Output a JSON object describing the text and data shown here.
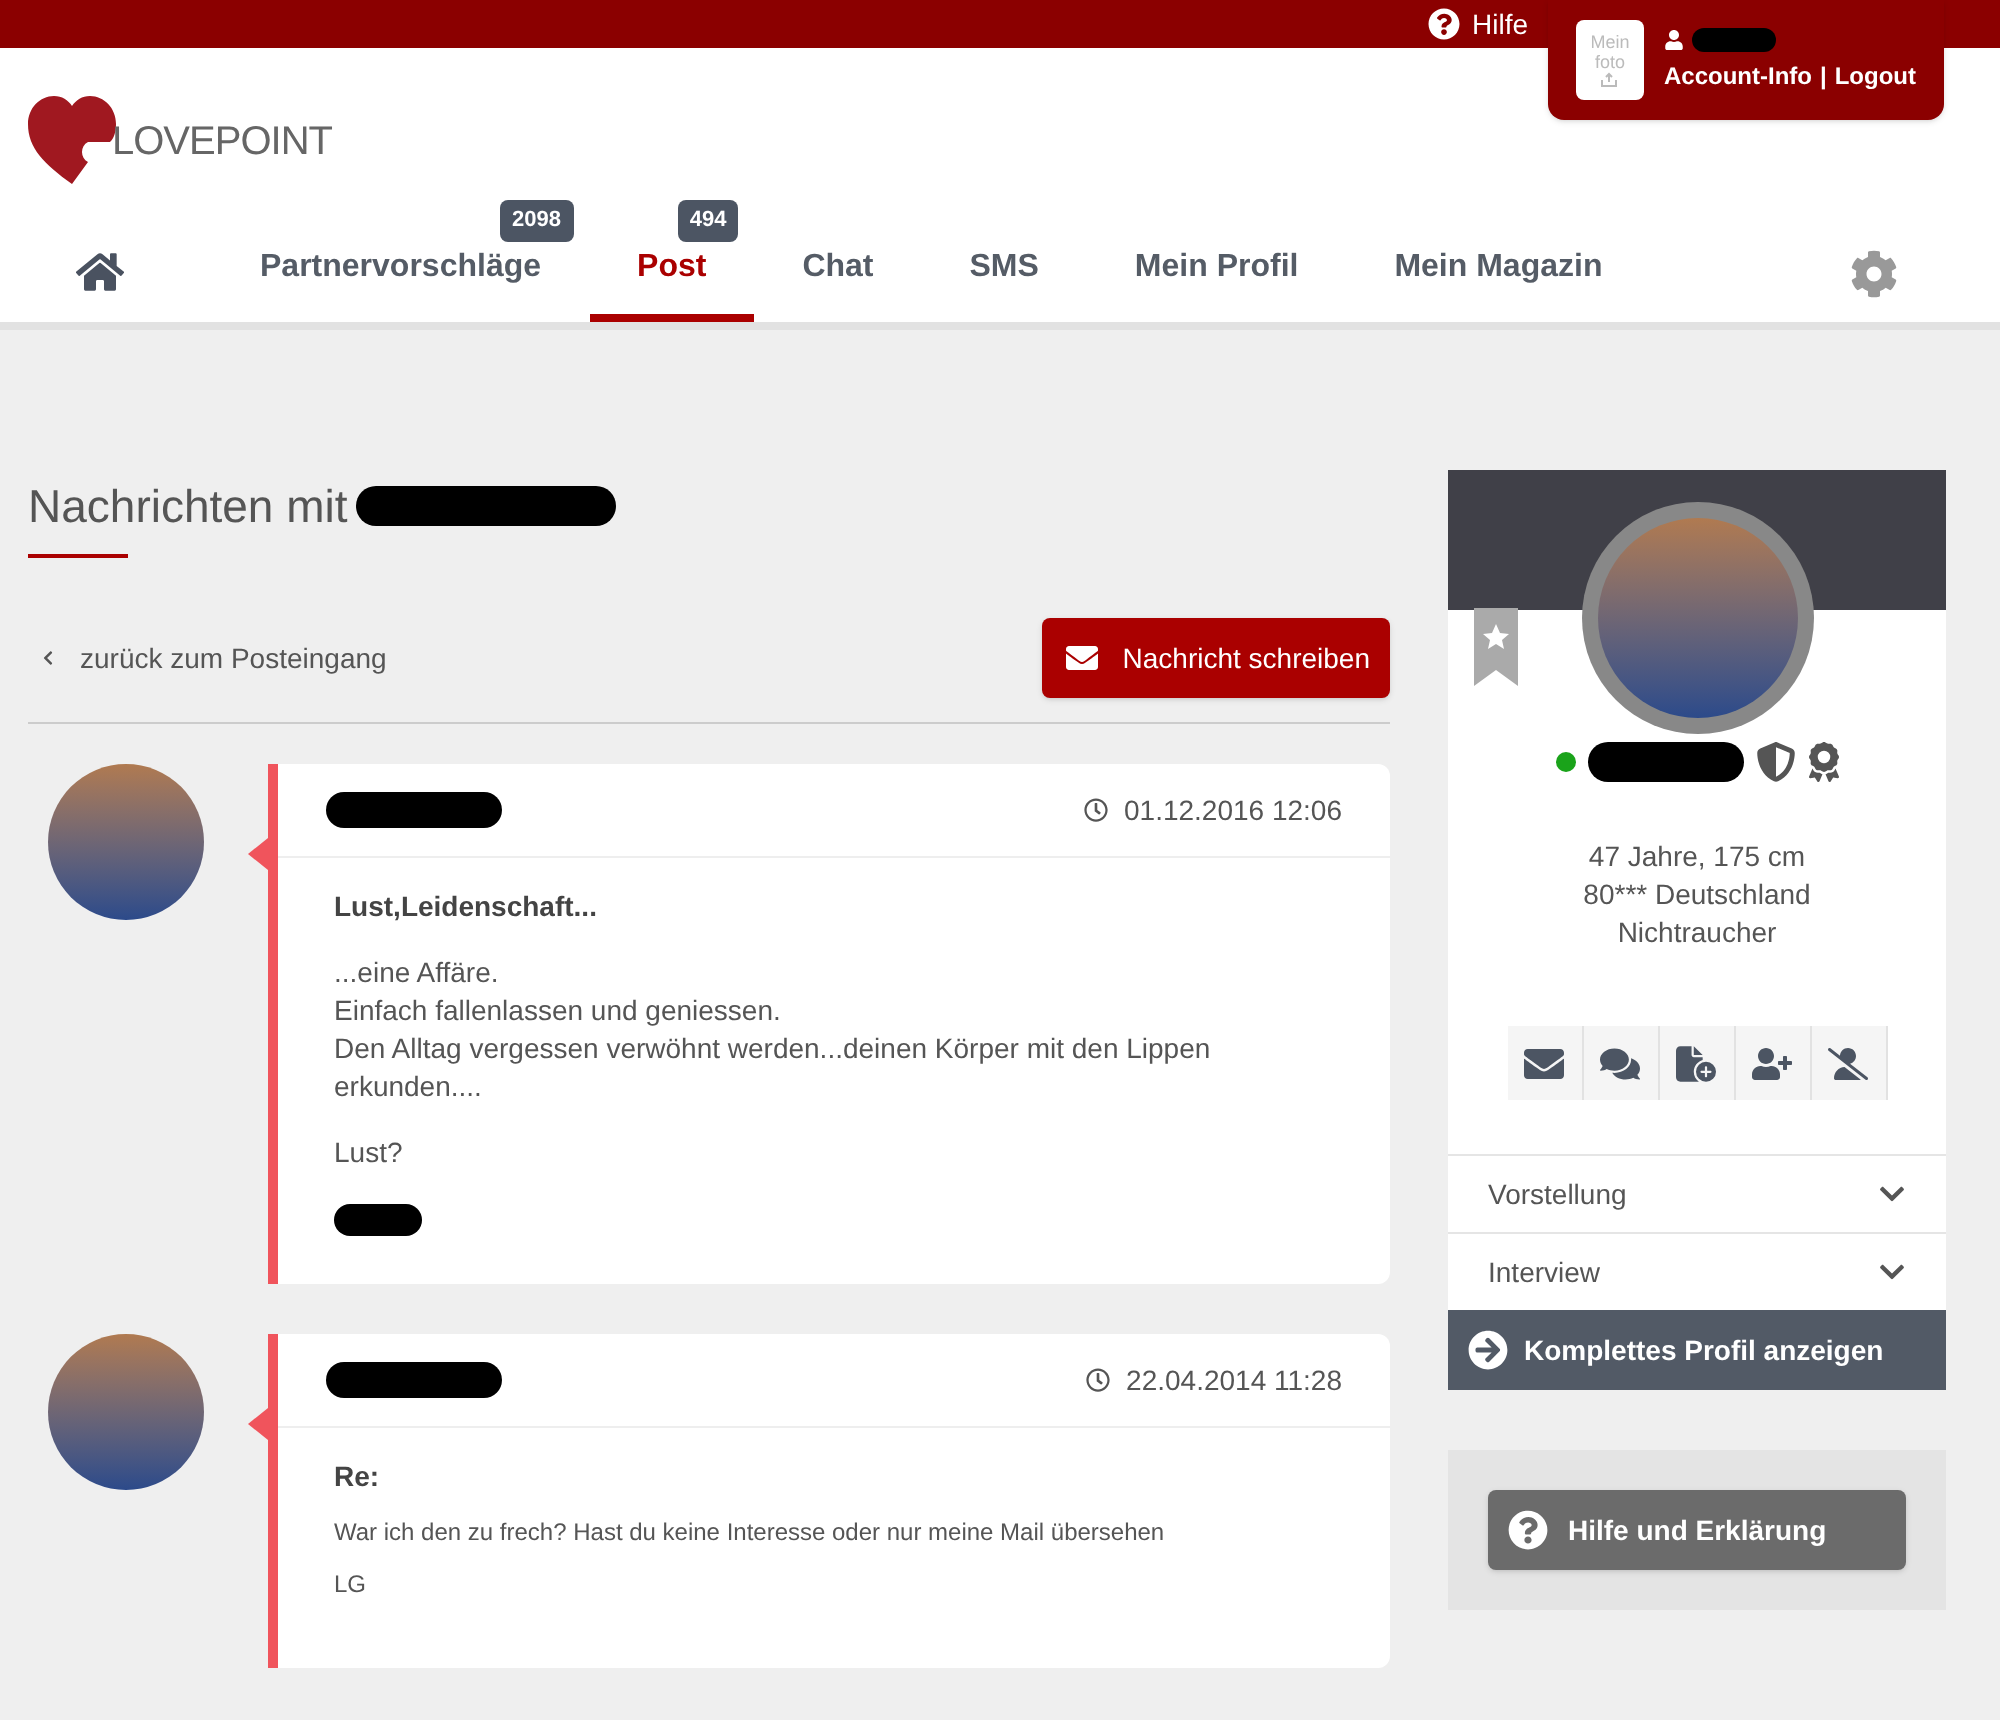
{
  "top_bar": {
    "help": "Hilfe",
    "account": {
      "photo_label": "Mein foto",
      "links": [
        "Account-Info",
        "Logout"
      ],
      "separator": "|"
    }
  },
  "logo": {
    "text": "LOVEPOINT"
  },
  "nav": {
    "items": [
      {
        "label": "Partnervorschläge",
        "selected": false,
        "badge": "2098"
      },
      {
        "label": "Post",
        "selected": true,
        "badge": "494"
      },
      {
        "label": "Chat",
        "selected": false
      },
      {
        "label": "SMS",
        "selected": false
      },
      {
        "label": "Mein Profil",
        "selected": false
      },
      {
        "label": "Mein Magazin",
        "selected": false
      }
    ]
  },
  "conversation": {
    "title": "Nachrichten mit",
    "back_link": "zurück zum Posteingang",
    "compose_button": "Nachricht schreiben",
    "messages": [
      {
        "date": "01.12.2016 12:06",
        "subject": "Lust,Leidenschaft...",
        "compact": false,
        "paragraphs": [
          "...eine Affäre.\nEinfach fallenlassen und geniessen.\nDen Alltag vergessen verwöhnt werden...deinen Körper mit den Lippen erkunden....",
          "Lust?"
        ]
      },
      {
        "date": "22.04.2014 11:28",
        "subject": "Re:",
        "compact": true,
        "paragraphs": [
          "War ich den zu frech? Hast du keine Interesse oder nur meine Mail übersehen",
          "LG"
        ]
      }
    ]
  },
  "profile": {
    "online": true,
    "details": [
      "47 Jahre, 175 cm",
      "80*** Deutschland",
      "Nichtraucher"
    ],
    "sections": [
      {
        "label": "Vorstellung",
        "expanded": false
      },
      {
        "label": "Interview",
        "expanded": false
      }
    ],
    "full_profile_button": "Komplettes Profil anzeigen",
    "help_button": "Hilfe und Erklärung"
  }
}
